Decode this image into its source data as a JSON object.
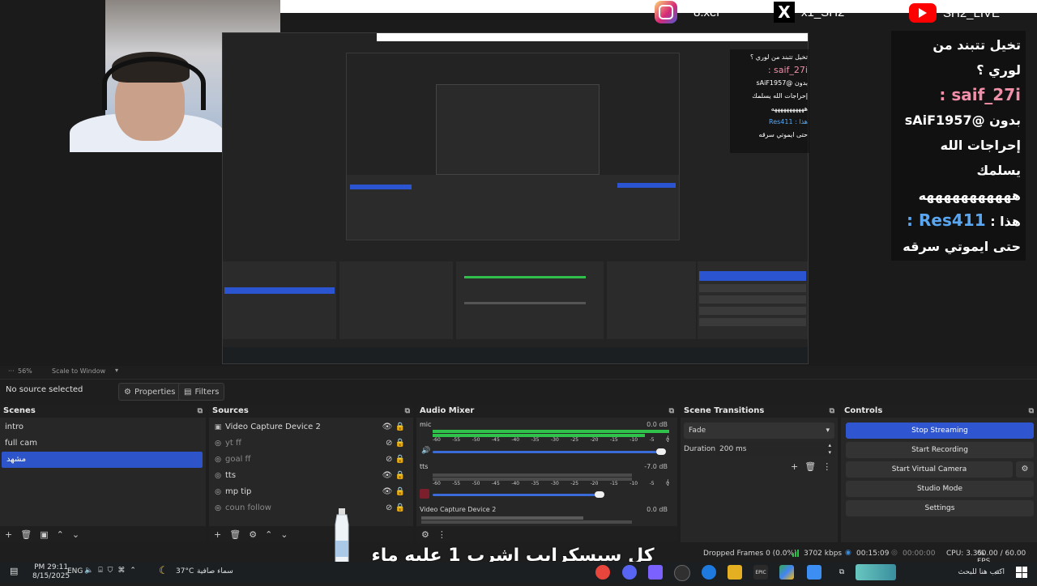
{
  "overlay": {
    "instagram_handle": "8.xel",
    "x_handle": "x1_SH2",
    "youtube_handle": "SH2_LIVE",
    "chat_question": "تخيل تتبند من لوري ؟",
    "chat_user1": "saif_27i :",
    "chat_msg1a": "بدون @sAiF1957",
    "chat_msg1b": "إحراجات الله يسلمك",
    "chat_msg1c": "هههههههههههه",
    "chat_user2": "Res411 :",
    "chat_prefix2": "هذا",
    "chat_msg2": "حتى ايموتي سرقه",
    "bottom_caption": "كل سبسكرايب اشرب 1 علبه ماء كامله"
  },
  "toolbar": {
    "zoom": "56%",
    "scale": "Scale to Window",
    "no_source": "No source selected",
    "properties": "Properties",
    "filters": "Filters"
  },
  "scenes": {
    "title": "Scenes",
    "items": [
      {
        "label": "intro"
      },
      {
        "label": "full cam"
      },
      {
        "label": "مشهد"
      }
    ]
  },
  "sources": {
    "title": "Sources",
    "items": [
      {
        "label": "Video Capture Device 2",
        "icon": "camera-icon",
        "visible": true
      },
      {
        "label": "yt ff",
        "icon": "browser-icon",
        "visible": false
      },
      {
        "label": "goal ff",
        "icon": "browser-icon",
        "visible": false
      },
      {
        "label": "tts",
        "icon": "browser-icon",
        "visible": true
      },
      {
        "label": "mp tip",
        "icon": "browser-icon",
        "visible": true
      },
      {
        "label": "coun follow",
        "icon": "browser-icon",
        "visible": false
      }
    ]
  },
  "audio": {
    "title": "Audio Mixer",
    "ticks": [
      "-60",
      "-55",
      "-50",
      "-45",
      "-40",
      "-35",
      "-30",
      "-25",
      "-20",
      "-15",
      "-10",
      "-5",
      "0"
    ],
    "channels": [
      {
        "name": "mic",
        "db": "0.0 dB",
        "level": 0.98,
        "muted": false
      },
      {
        "name": "tts",
        "db": "-7.0 dB",
        "level": 0.83,
        "muted": true
      },
      {
        "name": "Video Capture Device 2",
        "db": "0.0 dB",
        "level": 0.6,
        "muted": false
      }
    ]
  },
  "transitions": {
    "title": "Scene Transitions",
    "type": "Fade",
    "duration_label": "Duration",
    "duration_value": "200 ms"
  },
  "controls": {
    "title": "Controls",
    "stop_streaming": "Stop Streaming",
    "start_recording": "Start Recording",
    "start_virtual_camera": "Start Virtual Camera",
    "studio_mode": "Studio Mode",
    "settings": "Settings"
  },
  "status": {
    "dropped": "Dropped Frames 0 (0.0%)",
    "bitrate": "3702 kbps",
    "live_time": "00:15:09",
    "rec_time": "00:00:00",
    "cpu": "CPU: 3.3%",
    "fps": "60.00 / 60.00 FPS"
  },
  "taskbar": {
    "time": "PM 29:11",
    "date": "8/15/2025",
    "lang": "ENG",
    "weather_temp": "37°C",
    "weather_desc": "سماء صافية",
    "search_placeholder": "اكتب هنا للبحث"
  },
  "colors": {
    "accent": "#2f56d0",
    "live_red": "#e53935"
  }
}
